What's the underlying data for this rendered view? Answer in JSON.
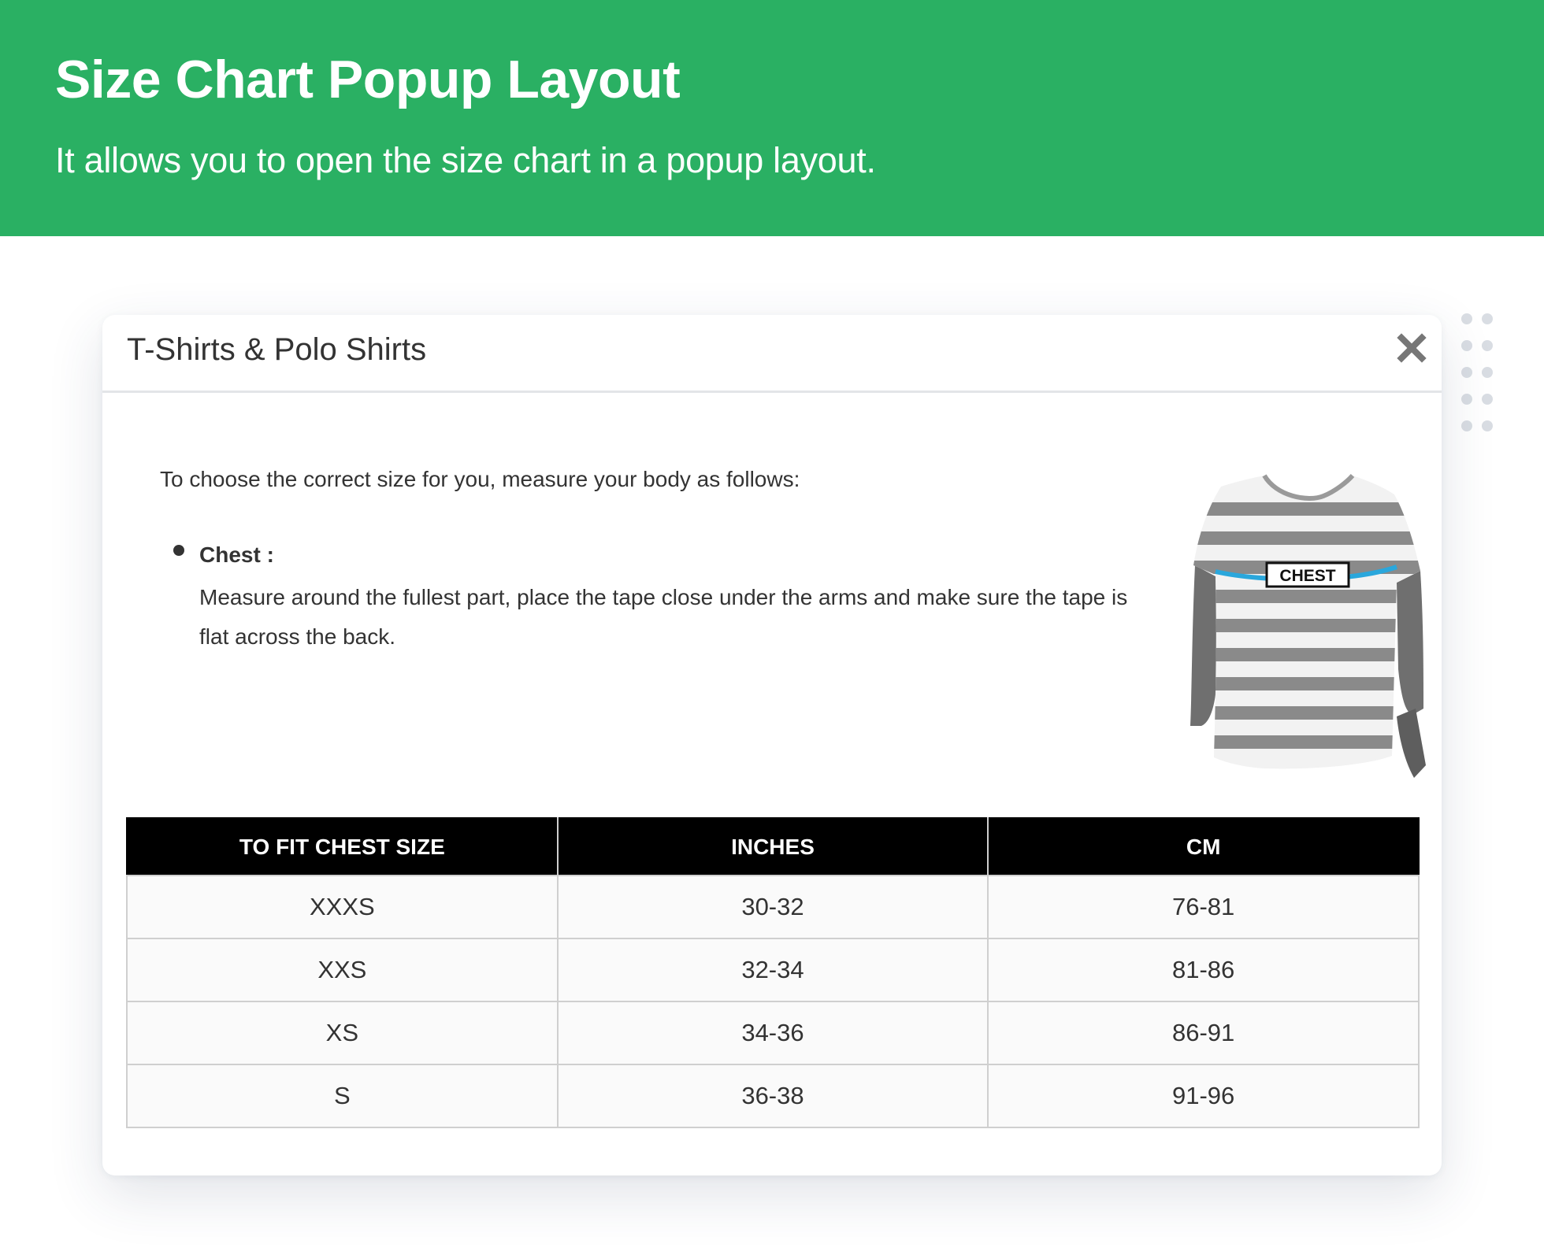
{
  "header": {
    "title": "Size Chart Popup Layout",
    "subtitle": "It allows you to open the size chart in a popup layout."
  },
  "popup": {
    "title": "T-Shirts & Polo Shirts",
    "close_icon": "close-icon",
    "intro": "To choose the correct size for you, measure your body as follows:",
    "measurements": [
      {
        "label": "Chest :",
        "description": "Measure around the fullest part, place the tape close under the arms and make sure the tape is flat across the back."
      }
    ],
    "image": {
      "icon": "tshirt-measurement-illustration",
      "label": "CHEST"
    },
    "table": {
      "headers": [
        "TO FIT CHEST SIZE",
        "INCHES",
        "CM"
      ],
      "rows": [
        [
          "XXXS",
          "30-32",
          "76-81"
        ],
        [
          "XXS",
          "32-34",
          "81-86"
        ],
        [
          "XS",
          "34-36",
          "86-91"
        ],
        [
          "S",
          "36-38",
          "91-96"
        ]
      ]
    }
  },
  "colors": {
    "brand_green": "#2ab063",
    "table_header_bg": "#000000",
    "tape_blue": "#2aa7dc"
  }
}
